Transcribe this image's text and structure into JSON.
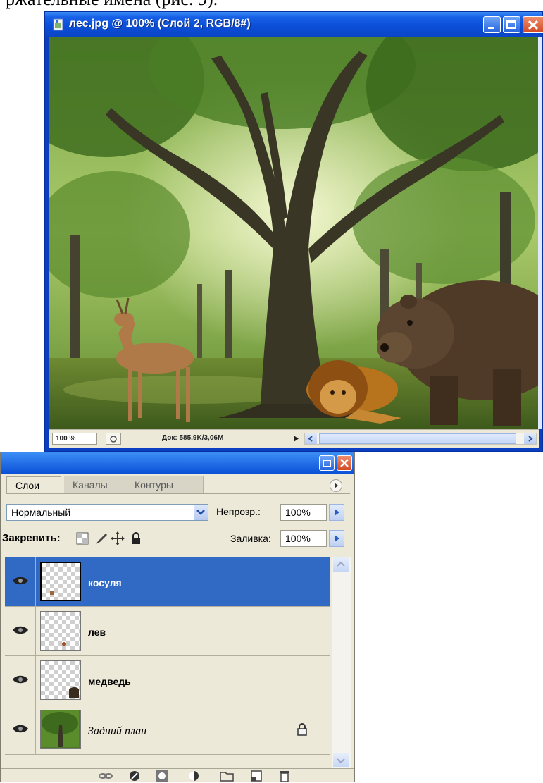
{
  "caption_fragment": "ржательные имена (рис. 9).",
  "document": {
    "title": "лес.jpg @ 100% (Слой 2, RGB/8#)",
    "zoom": "100 %",
    "doc_size": "Док: 585,9K/3,06M"
  },
  "layers_panel": {
    "tabs": [
      "Слои",
      "Каналы",
      "Контуры"
    ],
    "blend_mode": "Нормальный",
    "opacity_label": "Непрозр.:",
    "opacity_value": "100%",
    "lock_label": "Закрепить:",
    "fill_label": "Заливка:",
    "fill_value": "100%",
    "layers": [
      {
        "name": "косуля",
        "selected": true,
        "visible": true
      },
      {
        "name": "лев",
        "selected": false,
        "visible": true
      },
      {
        "name": "медведь",
        "selected": false,
        "visible": true
      },
      {
        "name": "Задний план",
        "selected": false,
        "visible": true,
        "locked": true
      }
    ],
    "footer_icons": [
      "link-layers-icon",
      "layer-style-icon",
      "layer-mask-icon",
      "adjustment-layer-icon",
      "new-group-icon",
      "new-layer-icon",
      "delete-layer-icon"
    ]
  },
  "colors": {
    "titlebar_blue": "#0b4fd8",
    "selected_layer": "#316ac5",
    "panel_bg": "#ece9d8"
  }
}
